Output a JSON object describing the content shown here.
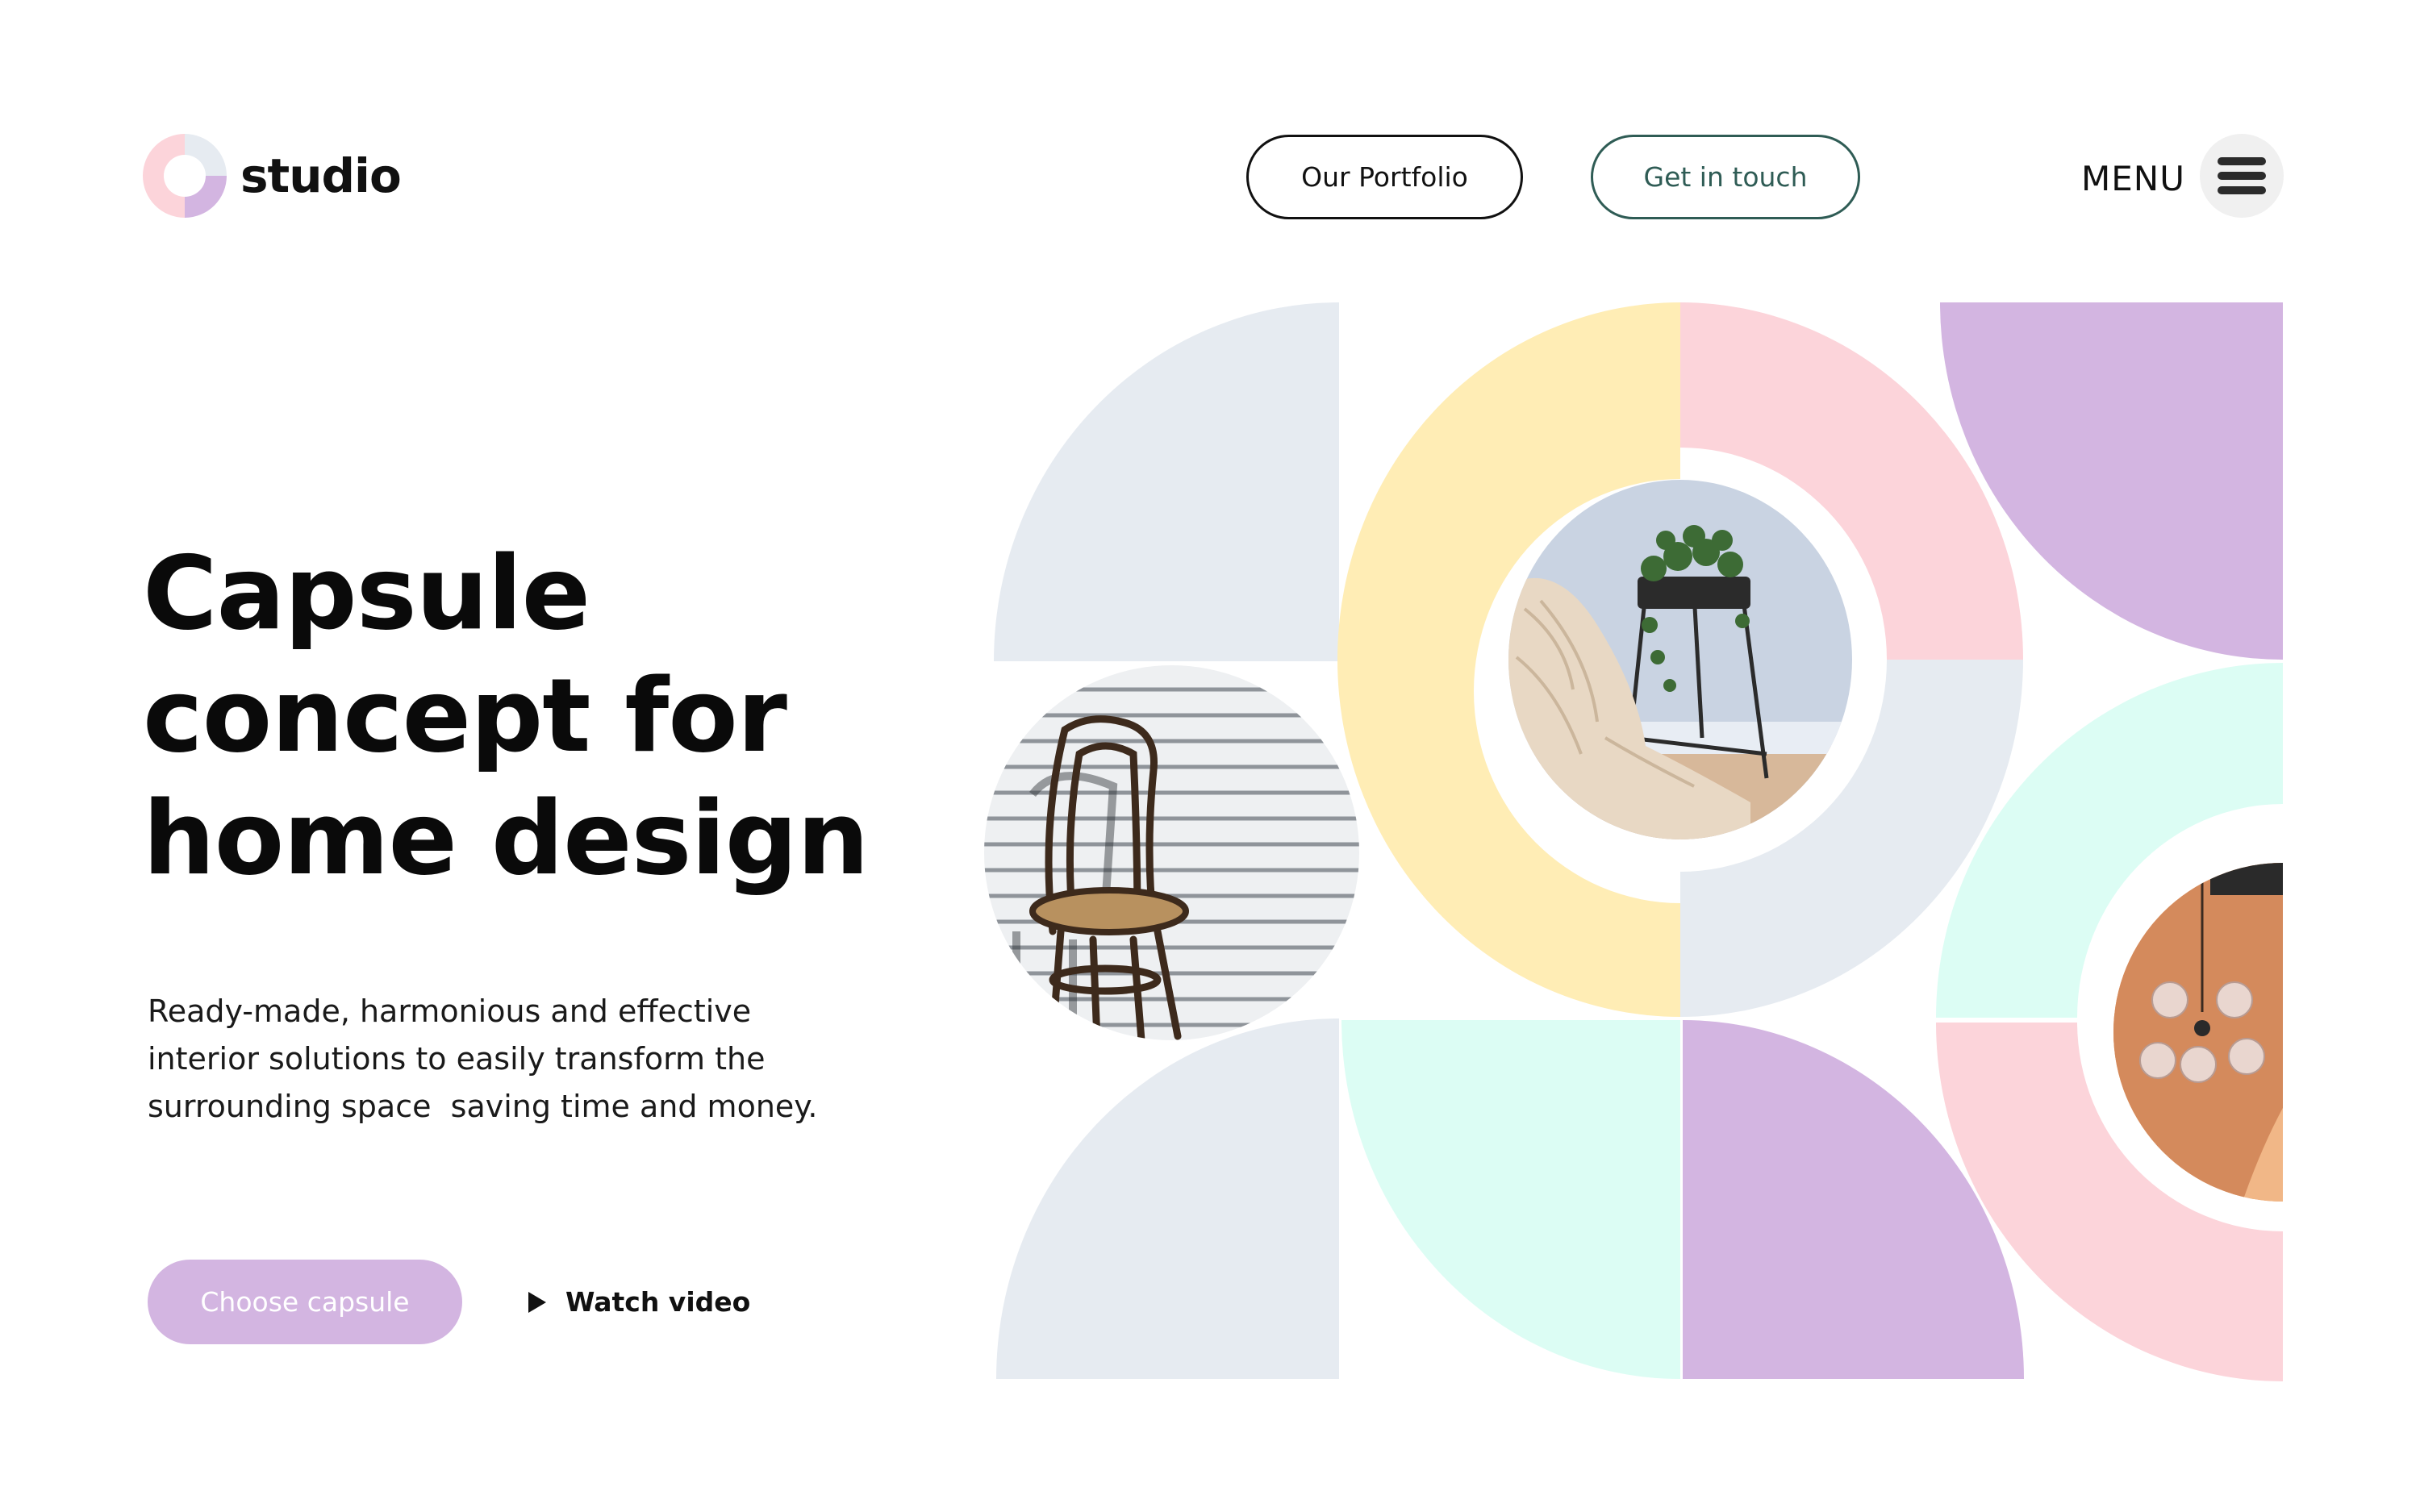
{
  "header": {
    "brand": "studio",
    "logo_icon": "studio-logo-icon",
    "nav": {
      "portfolio_label": "Our Portfolio",
      "contact_label": "Get in touch"
    },
    "menu_label": "MENU",
    "menu_icon": "hamburger-menu-icon"
  },
  "hero": {
    "headline_lines": [
      "Capsule",
      "concept for",
      "home design"
    ],
    "description_lines": [
      "Ready-made, harmonious and effective",
      "interior solutions to easily transform the",
      "surrounding space  saving time and money."
    ],
    "cta_label": "Choose capsule",
    "video_label": "Watch video",
    "video_icon": "play-icon"
  },
  "art": {
    "photos": [
      "bentwood-chair-photo",
      "plant-stand-blanket-photo",
      "pendant-lamp-photo"
    ]
  },
  "colors": {
    "lavender": "#d3b5e1",
    "pink": "#fcd4da",
    "yellow": "#ffedb5",
    "mint": "#dcfdf4",
    "light_gray": "#e6ebf1",
    "contact_border": "#2f5c55",
    "text_dark": "#111111"
  }
}
